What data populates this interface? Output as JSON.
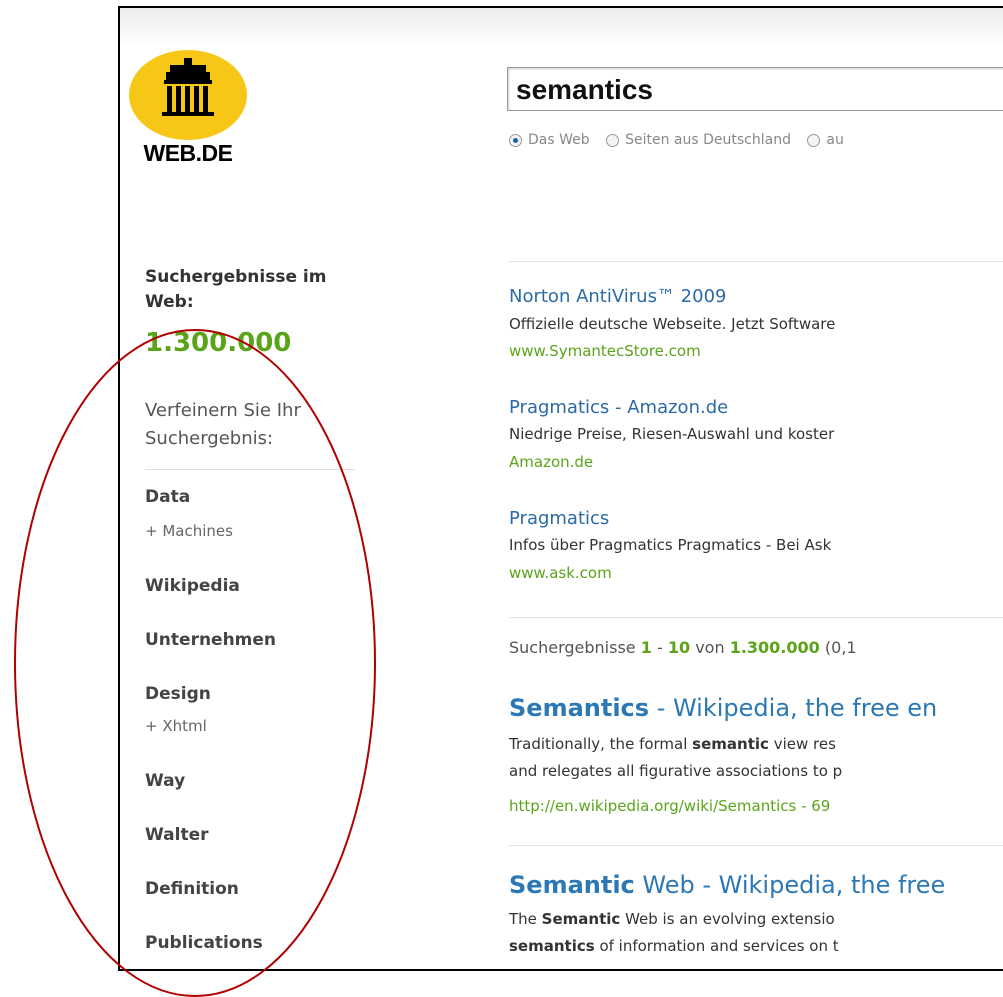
{
  "logo": {
    "text": "WEB.DE"
  },
  "search": {
    "query": "semantics",
    "options": [
      {
        "label": "Das Web",
        "selected": true
      },
      {
        "label": "Seiten aus Deutschland",
        "selected": false
      },
      {
        "label": "au",
        "selected": false
      }
    ]
  },
  "sidebar": {
    "heading": "Suchergebnisse im Web:",
    "count": "1.300.000",
    "refine": "Verfeinern Sie Ihr Suchergebnis:",
    "facets": [
      {
        "label": "Data",
        "sub": "+ Machines"
      },
      {
        "label": "Wikipedia",
        "sub": ""
      },
      {
        "label": "Unternehmen",
        "sub": ""
      },
      {
        "label": "Design",
        "sub": "+ Xhtml"
      },
      {
        "label": "Way",
        "sub": ""
      },
      {
        "label": "Walter",
        "sub": ""
      },
      {
        "label": "Definition",
        "sub": ""
      },
      {
        "label": "Publications",
        "sub": ""
      }
    ]
  },
  "ads": [
    {
      "title": "Norton AntiVirus™ 2009",
      "desc": "Offizielle deutsche Webseite. Jetzt Software",
      "url": "www.SymantecStore.com"
    },
    {
      "title": "Pragmatics - Amazon.de",
      "desc": "Niedrige Preise, Riesen-Auswahl und koster",
      "url": "Amazon.de"
    },
    {
      "title": "Pragmatics",
      "desc": "Infos über Pragmatics Pragmatics - Bei Ask",
      "url": "www.ask.com"
    }
  ],
  "summary": {
    "prefix": "Suchergebnisse",
    "from": "1",
    "dash": "-",
    "to": "10",
    "von": "von",
    "total": "1.300.000",
    "suffix": "(0,1"
  },
  "results": [
    {
      "title_bold": "Semantics",
      "title_rest": " - Wikipedia, the free en",
      "line1_a": "Traditionally, the formal ",
      "line1_b": "semantic",
      "line1_c": " view res",
      "line2": "and relegates all figurative associations to p",
      "url": "http://en.wikipedia.org/wiki/Semantics - 69"
    },
    {
      "title_bold": "Semantic",
      "title_rest": " Web - Wikipedia, the free",
      "line1_a": "The ",
      "line1_b": "Semantic",
      "line1_c": " Web is an evolving extensio",
      "line2_bold": "semantics",
      "line2": " of information and services on t"
    }
  ],
  "colors": {
    "link": "#2b78b4",
    "green": "#5aa419",
    "annotation": "#b00000",
    "logo_yellow": "#f7c718"
  }
}
